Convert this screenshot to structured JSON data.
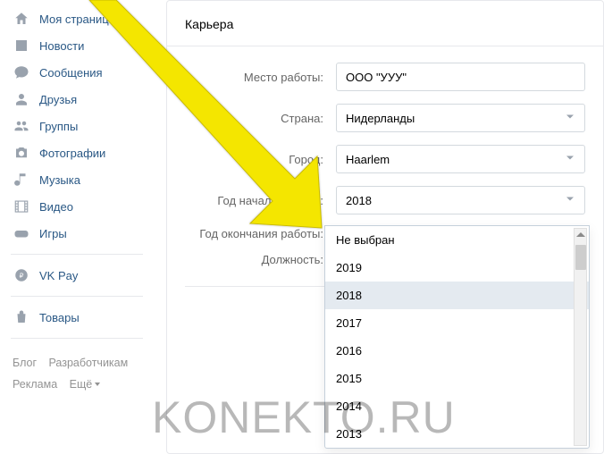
{
  "sidebar": {
    "items": [
      {
        "label": "Моя страница",
        "icon": "home-icon"
      },
      {
        "label": "Новости",
        "icon": "news-icon"
      },
      {
        "label": "Сообщения",
        "icon": "messages-icon"
      },
      {
        "label": "Друзья",
        "icon": "friends-icon"
      },
      {
        "label": "Группы",
        "icon": "groups-icon"
      },
      {
        "label": "Фотографии",
        "icon": "photos-icon"
      },
      {
        "label": "Музыка",
        "icon": "music-icon"
      },
      {
        "label": "Видео",
        "icon": "video-icon"
      },
      {
        "label": "Игры",
        "icon": "games-icon"
      }
    ],
    "items2": [
      {
        "label": "VK Pay",
        "icon": "vkpay-icon"
      }
    ],
    "items3": [
      {
        "label": "Товары",
        "icon": "market-icon"
      }
    ]
  },
  "footer": {
    "blog": "Блог",
    "developers": "Разработчикам",
    "ads": "Реклама",
    "more": "Ещё"
  },
  "card": {
    "title": "Карьера",
    "labels": {
      "workplace": "Место работы:",
      "country": "Страна:",
      "city": "Город:",
      "year_start": "Год начала работы:",
      "year_end": "Год окончания работы:",
      "position": "Должность:"
    },
    "values": {
      "workplace": "ООО \"УУУ\"",
      "country": "Нидерланды",
      "city": "Haarlem",
      "year_start": "2018",
      "year_end": "",
      "position": ""
    },
    "add_plus": "+"
  },
  "dropdown": {
    "options": [
      "Не выбран",
      "2019",
      "2018",
      "2017",
      "2016",
      "2015",
      "2014",
      "2013"
    ],
    "selected": "2018"
  },
  "watermark": "KONEKTO.RU"
}
